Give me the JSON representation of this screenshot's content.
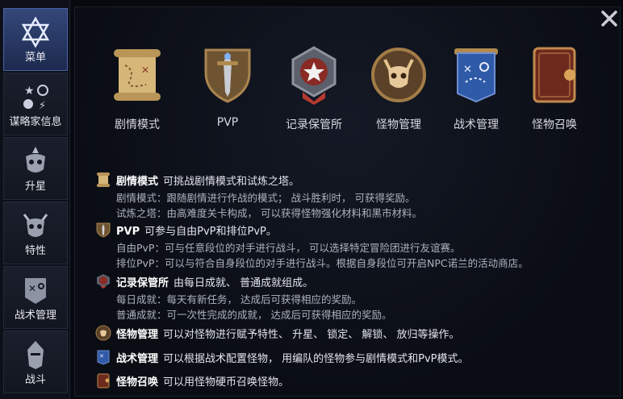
{
  "sidebar": {
    "items": [
      {
        "label": "菜单",
        "icon": "star-of-david-icon",
        "active": true
      },
      {
        "label": "谋略家信息",
        "icon": "strategist-info-icon",
        "active": false
      },
      {
        "label": "升星",
        "icon": "star-up-demon-icon",
        "active": false
      },
      {
        "label": "特性",
        "icon": "trait-demon-icon",
        "active": false
      },
      {
        "label": "战术管理",
        "icon": "tactics-board-icon",
        "active": false
      },
      {
        "label": "战斗",
        "icon": "knight-helmet-icon",
        "active": false
      }
    ]
  },
  "close_icon": "close-x-icon",
  "tiles": [
    {
      "label": "剧情模式",
      "icon": "scroll-map-icon"
    },
    {
      "label": "PVP",
      "icon": "sword-shield-icon"
    },
    {
      "label": "记录保管所",
      "icon": "star-emblem-icon"
    },
    {
      "label": "怪物管理",
      "icon": "demon-medallion-icon"
    },
    {
      "label": "战术管理",
      "icon": "tactics-banner-icon"
    },
    {
      "label": "怪物召唤",
      "icon": "summon-book-icon"
    }
  ],
  "entries": [
    {
      "title": "剧情模式",
      "summary": "可挑战剧情模式和试炼之塔。",
      "icon": "scroll-map-icon",
      "lines": [
        "剧情模式：跟随剧情进行作战的模式； 战斗胜利时， 可获得奖励。",
        "试炼之塔：由高难度关卡构成， 可以获得怪物强化材料和黑市材料。"
      ]
    },
    {
      "title": "PVP",
      "summary": "可参与自由PvP和排位PvP。",
      "icon": "sword-shield-icon",
      "lines": [
        "自由PvP：可与任意段位的对手进行战斗， 可以选择特定冒险团进行友谊赛。",
        "排位PvP：可以与符合自身段位的对手进行战斗。根据自身段位可开启NPC诺兰的活动商店。"
      ]
    },
    {
      "title": "记录保管所",
      "summary": "由每日成就、 普通成就组成。",
      "icon": "star-emblem-icon",
      "lines": [
        "每日成就：每天有新任务， 达成后可获得相应的奖励。",
        "普通成就：可一次性完成的成就， 达成后可获得相应的奖励。"
      ]
    },
    {
      "title": "怪物管理",
      "summary": "可以对怪物进行赋予特性、 升星、 锁定、 解锁、 放归等操作。",
      "icon": "demon-medallion-icon",
      "lines": []
    },
    {
      "title": "战术管理",
      "summary": "可以根据战术配置怪物， 用编队的怪物参与剧情模式和PvP模式。",
      "icon": "tactics-banner-icon",
      "lines": []
    },
    {
      "title": "怪物召唤",
      "summary": "可以用怪物硬币召唤怪物。",
      "icon": "summon-book-icon",
      "lines": []
    }
  ],
  "colors": {
    "accent": "#34477a",
    "panel": "#0a0d14",
    "text": "#c9ccd6"
  }
}
